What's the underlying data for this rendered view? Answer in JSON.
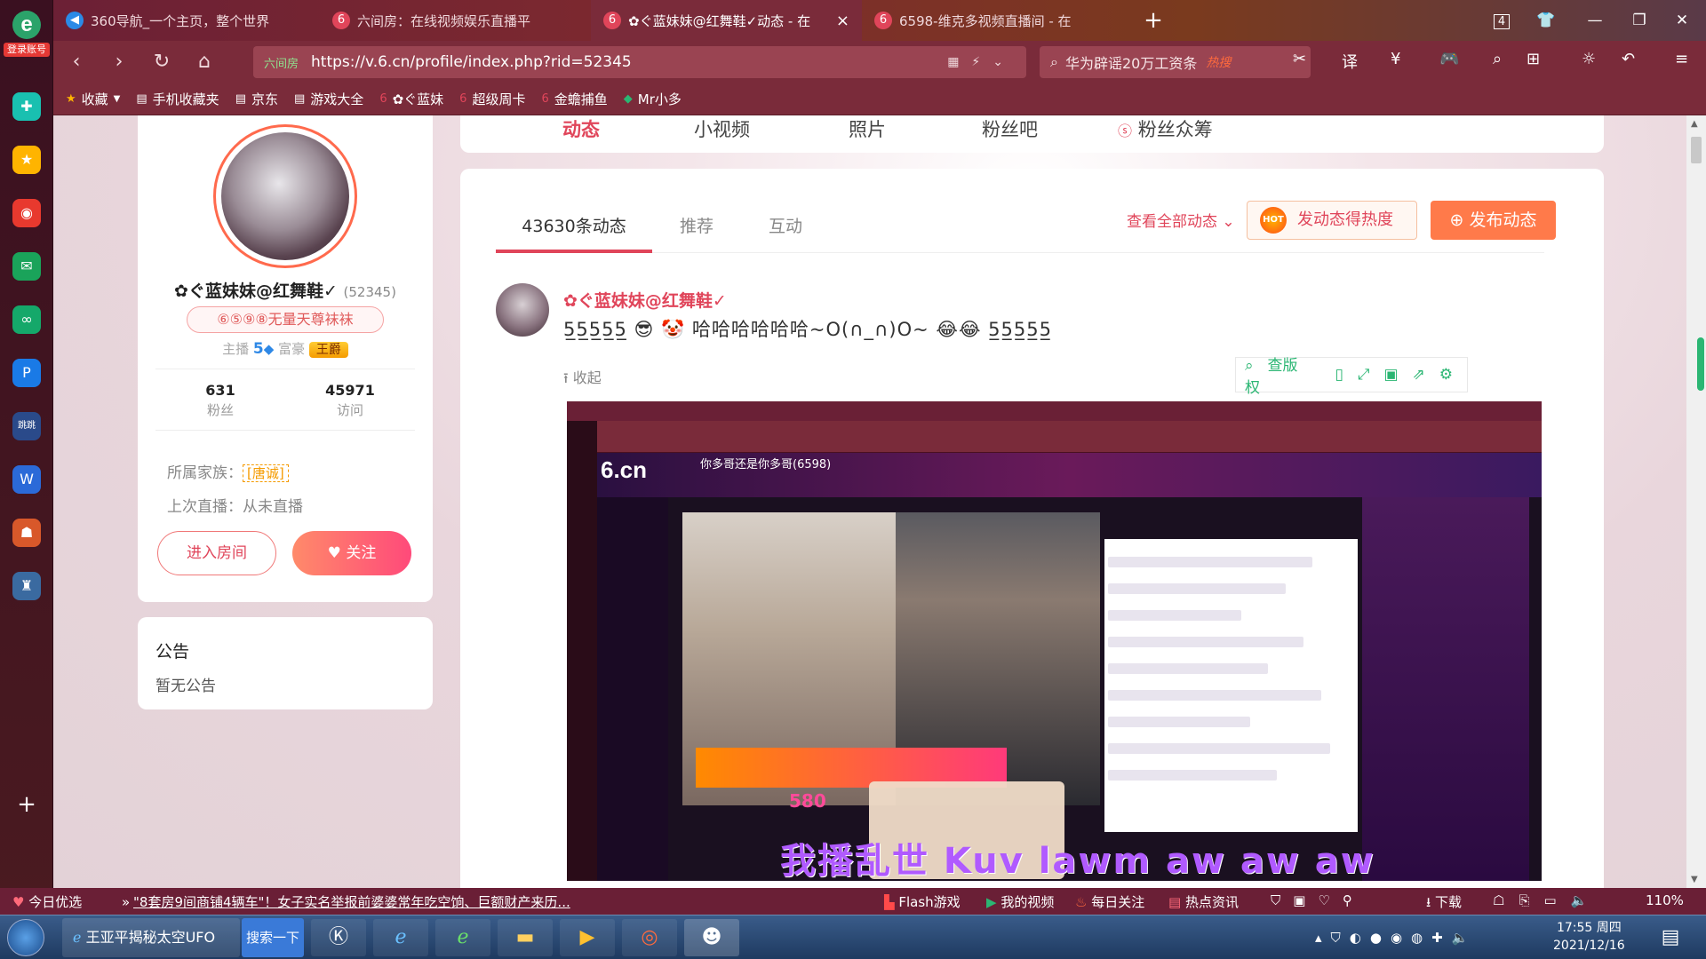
{
  "dock": {
    "tag": "登录账号",
    "logo": "e"
  },
  "tabs": [
    {
      "title": "360导航_一个主页，整个世界",
      "icon": "360-icon"
    },
    {
      "title": "六间房：在线视频娱乐直播平",
      "icon": "6cn-icon"
    },
    {
      "title": "✿ぐ蓝妹妹@红舞鞋✓动态 - 在",
      "icon": "6cn-icon",
      "active": true
    },
    {
      "title": "6598-维克多视频直播间 - 在",
      "icon": "6cn-icon"
    }
  ],
  "window": {
    "tab_count": "4"
  },
  "nav": {
    "url": "https://v.6.cn/profile/index.php?rid=52345",
    "security": "六间房",
    "search_text": "华为辟谣20万工资条",
    "search_hot": "热搜"
  },
  "bookmarks": [
    "收藏",
    "手机收藏夹",
    "京东",
    "游戏大全",
    "✿ぐ蓝妹",
    "超级周卡",
    "金蟾捕鱼",
    "Mr小多"
  ],
  "profile": {
    "name": "✿ぐ蓝妹妹@红舞鞋✓",
    "rid": "(52345)",
    "title_badge": "⑥⑤⑨⑧无量天尊袜袜",
    "level_label1": "主播",
    "level_value": "5",
    "level_label2": "富豪",
    "wealth_badge": "王爵",
    "fans_count": "631",
    "fans_label": "粉丝",
    "visits_count": "45971",
    "visits_label": "访问",
    "family_label": "所属家族：",
    "family_value": "[唐诚]",
    "last_live": "上次直播：从未直播",
    "enter_room": "进入房间",
    "follow": "关注"
  },
  "notice": {
    "title": "公告",
    "content": "暂无公告"
  },
  "top_nav": [
    "动态",
    "小视频",
    "照片",
    "粉丝吧",
    "粉丝众筹"
  ],
  "feed": {
    "tabs": [
      "43630条动态",
      "推荐",
      "互动"
    ],
    "view_all": "查看全部动态",
    "hot_button": "发动态得热度",
    "hot_icon_text": "HOT",
    "publish_button": "发布动态",
    "post_author": "✿ぐ蓝妹妹@红舞鞋✓",
    "post_text": "5̲5̲5̲5̲5̲ 😎 🤡 哈哈哈哈哈哈~O(∩_∩)O~ 😂😂 5̲5̲5̲5̲5̲",
    "collapse": "收起",
    "tools": [
      "查版权"
    ]
  },
  "embedded": {
    "logo": "6.cn",
    "streamer": "你多哥还是你多哥(6598)",
    "battle": "580",
    "watermark": "我播乱世  Kuv lawm aw aw aw"
  },
  "statusbar": {
    "left": "今日优选",
    "headline": "\"8套房9间商铺4辆车\"！女子实名举报前婆婆常年吃空饷、巨额财产来历...",
    "flash": "Flash游戏",
    "myvideo": "我的视频",
    "daily": "每日关注",
    "hotinfo": "热点资讯",
    "download": "下载",
    "zoom": "110%"
  },
  "taskbar": {
    "ie_item": "王亚平揭秘太空UFO",
    "search_btn": "搜索一下",
    "time": "17:55 周四",
    "date": "2021/12/16"
  }
}
